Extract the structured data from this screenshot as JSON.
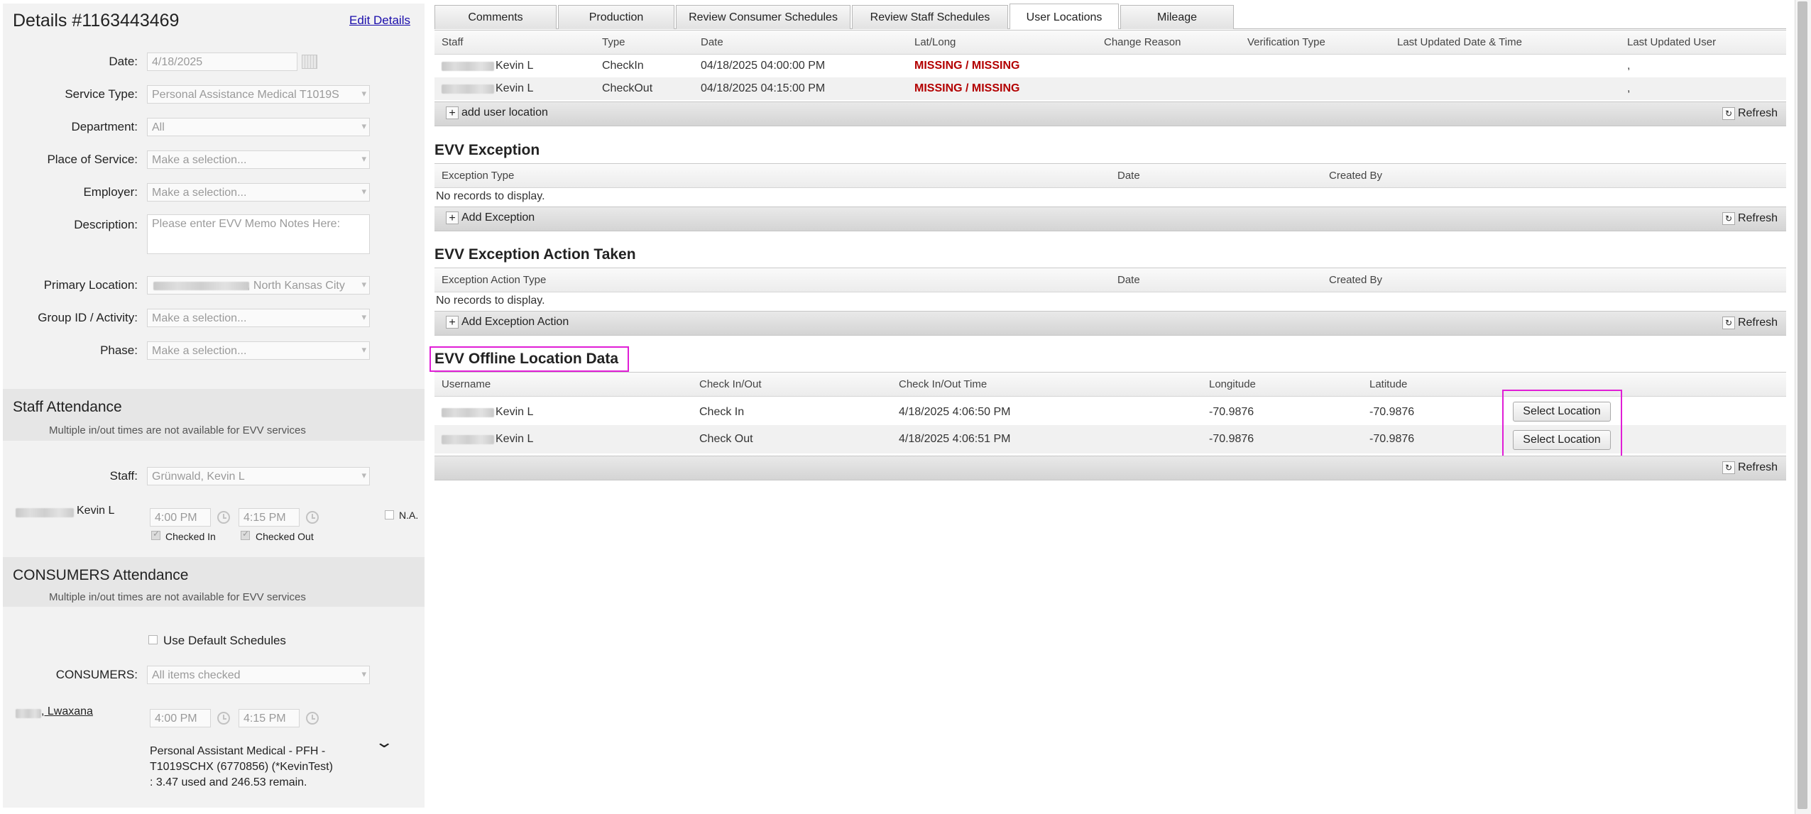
{
  "details": {
    "title": "Details #1163443469",
    "edit_link": "Edit Details",
    "fields": {
      "date_label": "Date:",
      "date_value": "4/18/2025",
      "service_type_label": "Service Type:",
      "service_type_value": "Personal Assistance Medical T1019S",
      "department_label": "Department:",
      "department_value": "All",
      "place_label": "Place of Service:",
      "place_value": "Make a selection...",
      "employer_label": "Employer:",
      "employer_value": "Make a selection...",
      "description_label": "Description:",
      "description_placeholder": "Please enter EVV Memo Notes Here:",
      "primary_location_label": "Primary Location:",
      "primary_location_value": ", North Kansas City",
      "group_label": "Group ID / Activity:",
      "group_value": "Make a selection...",
      "phase_label": "Phase:",
      "phase_value": "Make a selection..."
    }
  },
  "staff_attendance": {
    "title": "Staff Attendance",
    "note": "Multiple in/out times are not available for EVV services",
    "staff_label": "Staff:",
    "staff_value": "Grünwald, Kevin L",
    "person_name": "Kevin L",
    "time_in": "4:00 PM",
    "time_out": "4:15 PM",
    "checked_in_label": "Checked In",
    "checked_out_label": "Checked Out",
    "na_label": "N.A."
  },
  "consumers_attendance": {
    "title": "CONSUMERS Attendance",
    "note": "Multiple in/out times are not available for EVV services",
    "default_schedules_label": "Use Default Schedules",
    "consumers_label": "CONSUMERS:",
    "consumers_value": "All items checked",
    "consumer_name": ", Lwaxana",
    "time_in": "4:00 PM",
    "time_out": "4:15 PM",
    "auth_line1": "Personal Assistant Medical - PFH -",
    "auth_line2": "T1019SCHX (6770856) (*KevinTest)",
    "auth_line3": ": 3.47 used and 246.53 remain."
  },
  "tabs": [
    "Comments",
    "Production",
    "Review Consumer Schedules",
    "Review Staff Schedules",
    "User Locations",
    "Mileage"
  ],
  "active_tab": "User Locations",
  "user_locations": {
    "columns": [
      "Staff",
      "Type",
      "Date",
      "Lat/Long",
      "Change Reason",
      "Verification Type",
      "Last Updated Date & Time",
      "Last Updated User"
    ],
    "rows": [
      {
        "staff": "Kevin L",
        "type": "CheckIn",
        "date": "04/18/2025 04:00:00 PM",
        "latlong": "MISSING / MISSING",
        "last_user": ","
      },
      {
        "staff": "Kevin L",
        "type": "CheckOut",
        "date": "04/18/2025 04:15:00 PM",
        "latlong": "MISSING / MISSING",
        "last_user": ","
      }
    ],
    "add_label": "add user location",
    "refresh_label": "Refresh"
  },
  "evv_exception": {
    "title": "EVV Exception",
    "columns": [
      "Exception Type",
      "Date",
      "Created By"
    ],
    "empty": "No records to display.",
    "add_label": "Add Exception",
    "refresh_label": "Refresh"
  },
  "evv_exception_action": {
    "title": "EVV Exception Action Taken",
    "columns": [
      "Exception Action Type",
      "Date",
      "Created By"
    ],
    "empty": "No records to display.",
    "add_label": "Add Exception Action",
    "refresh_label": "Refresh"
  },
  "evv_offline": {
    "title": "EVV Offline Location Data",
    "columns": [
      "Username",
      "Check In/Out",
      "Check In/Out Time",
      "Longitude",
      "Latitude"
    ],
    "rows": [
      {
        "username": "Kevin L",
        "check": "Check In",
        "time": "4/18/2025 4:06:50 PM",
        "longitude": "-70.9876",
        "latitude": "-70.9876",
        "button": "Select Location"
      },
      {
        "username": "Kevin L",
        "check": "Check Out",
        "time": "4/18/2025 4:06:51 PM",
        "longitude": "-70.9876",
        "latitude": "-70.9876",
        "button": "Select Location"
      }
    ],
    "refresh_label": "Refresh"
  },
  "colors": {
    "highlight": "#e01ed6",
    "missing_red": "#b30000",
    "panel_bg": "#f2f2f2"
  }
}
